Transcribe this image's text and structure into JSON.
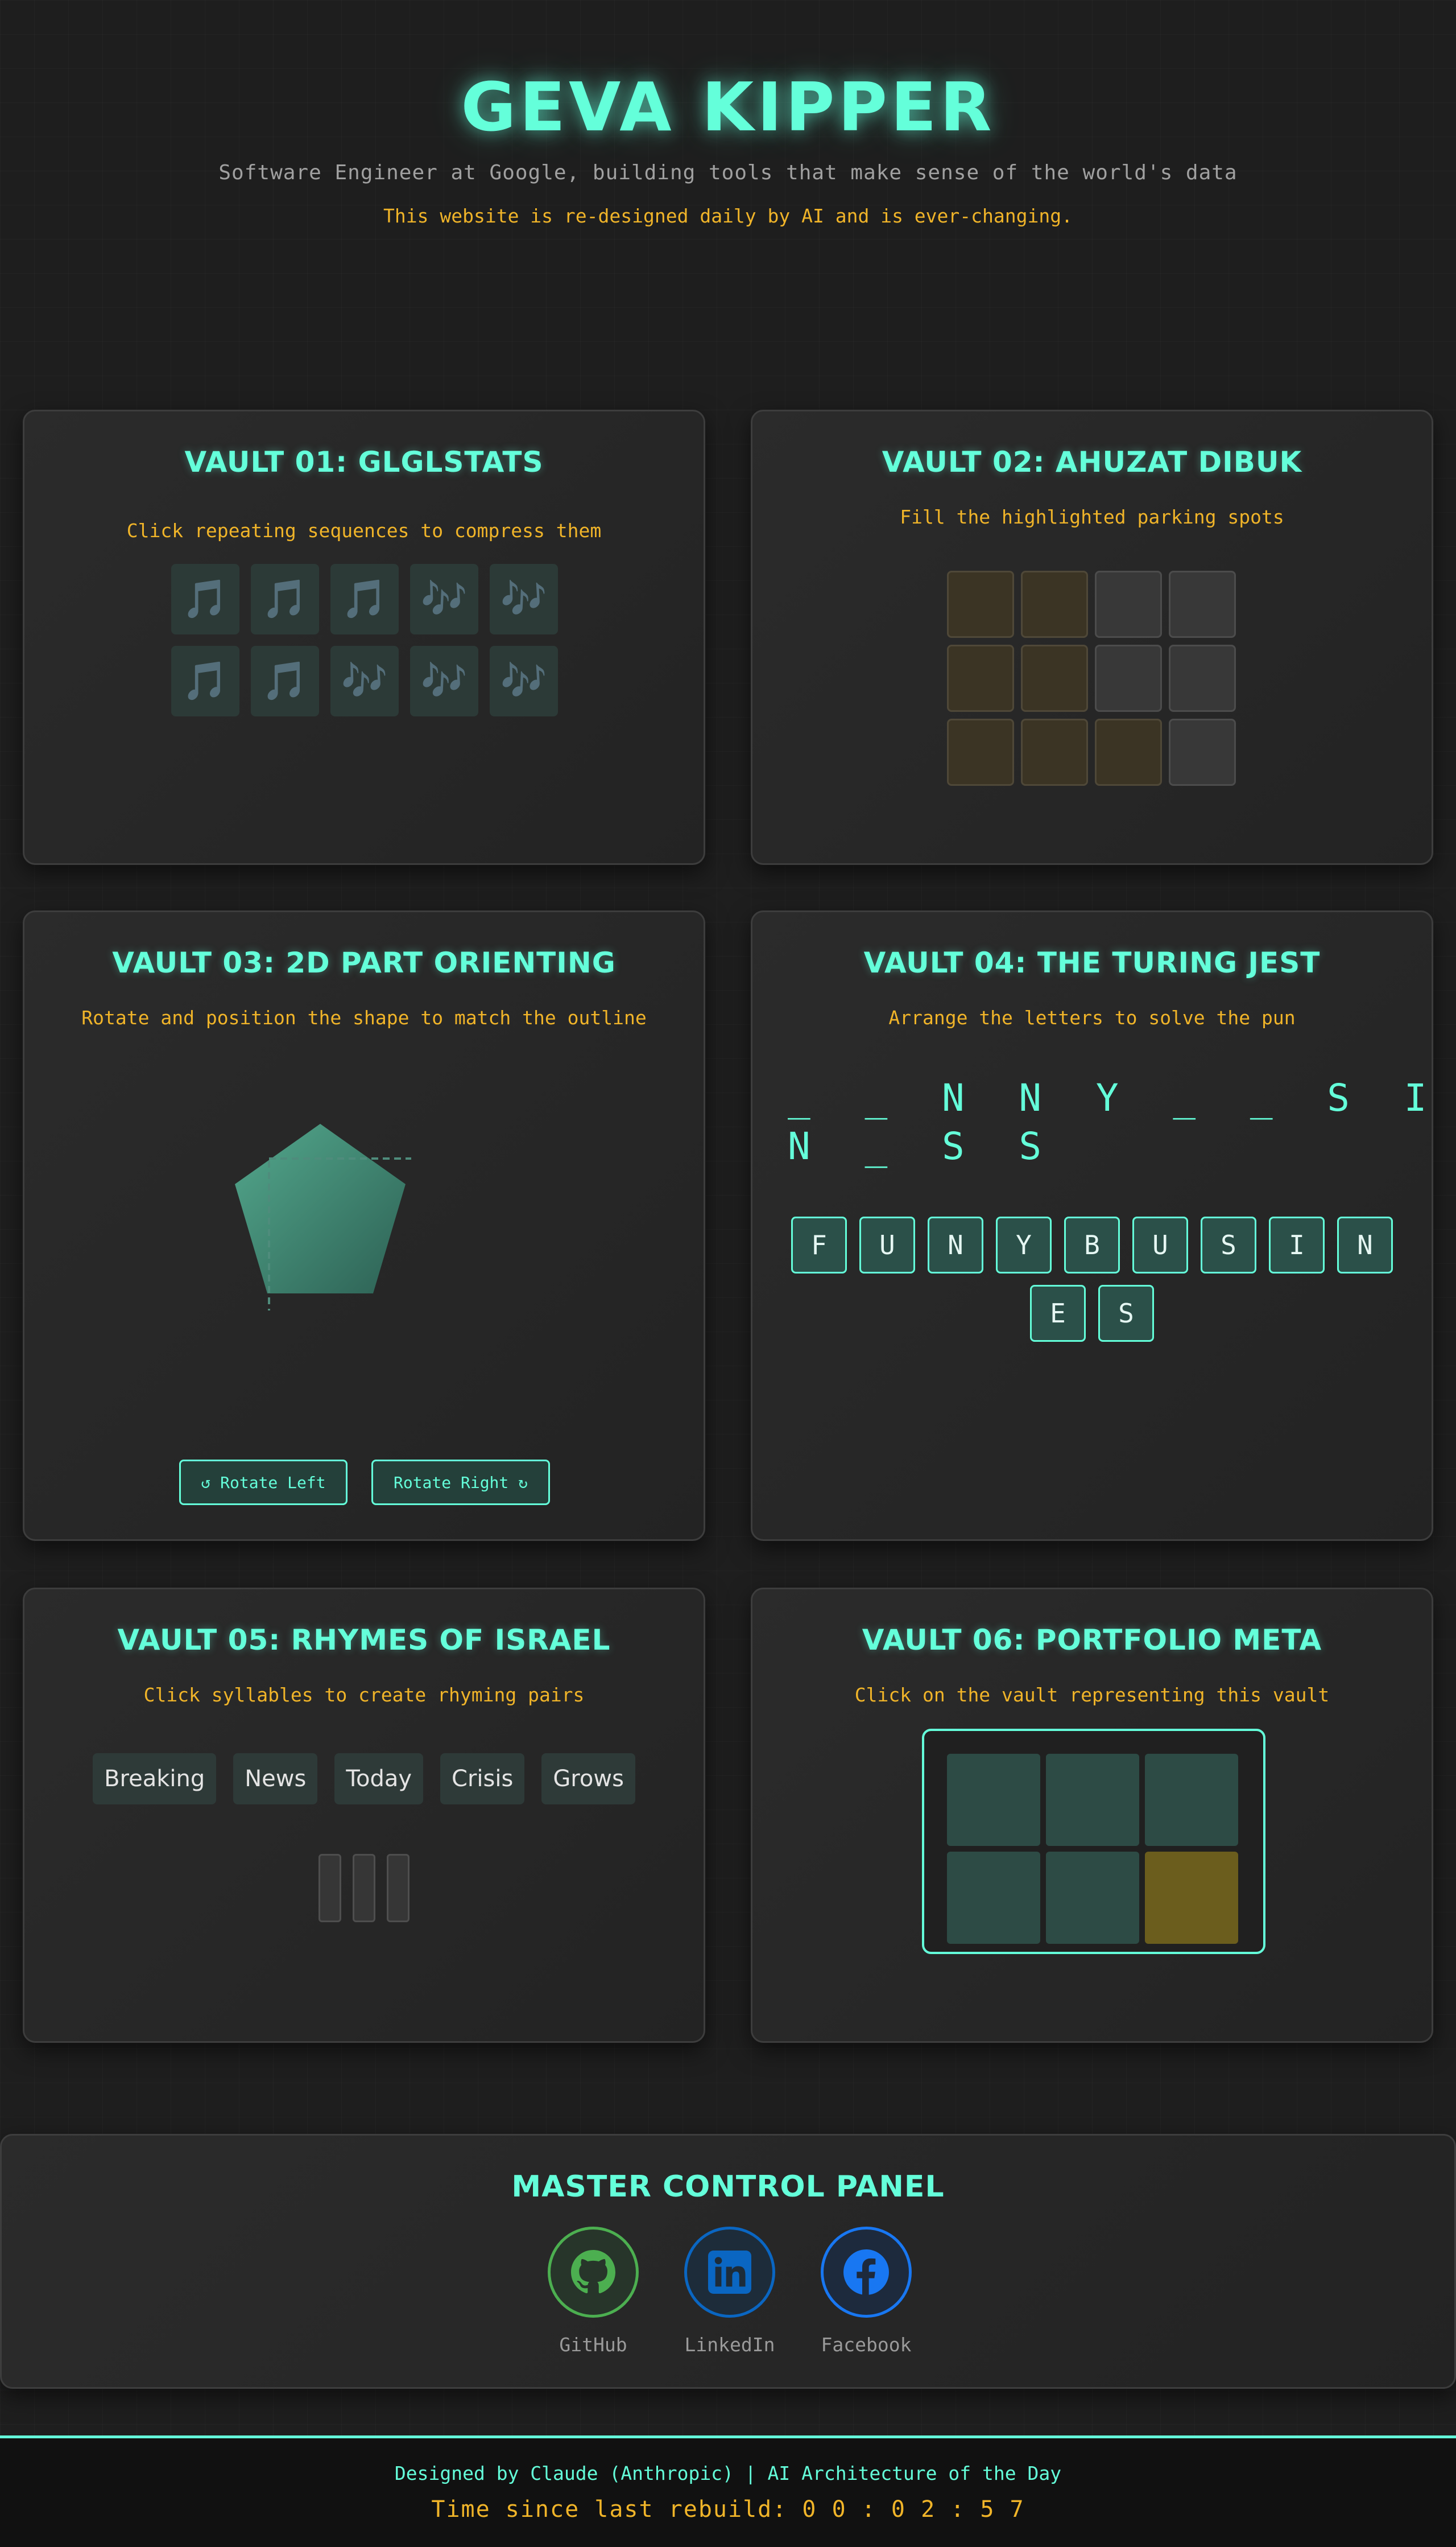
{
  "header": {
    "title": "GEVA KIPPER",
    "subtitle": "Software Engineer at Google, building tools that make sense of the world's data",
    "notice": "This website is re-designed daily by AI and is ever-changing."
  },
  "vaults": [
    {
      "title": "VAULT 01: GLGLSTATS",
      "instruction": "Click repeating sequences to compress them",
      "tiles": [
        "🎵",
        "🎵",
        "🎵",
        "🎶",
        "🎶",
        "🎵",
        "🎵",
        "🎶",
        "🎶",
        "🎶"
      ]
    },
    {
      "title": "VAULT 02: AHUZAT DIBUK",
      "instruction": "Fill the highlighted parking spots",
      "spots": [
        true,
        true,
        false,
        false,
        true,
        true,
        false,
        false,
        true,
        true,
        true,
        false
      ]
    },
    {
      "title": "VAULT 03: 2D PART ORIENTING",
      "instruction": "Rotate and position the shape to match the outline",
      "rotate_left_label": "↺ Rotate Left",
      "rotate_right_label": "Rotate Right ↻"
    },
    {
      "title": "VAULT 04: THE TURING JEST",
      "instruction": "Arrange the letters to solve the pun",
      "puzzle_line1": "_ _ N N Y _ _ S I",
      "puzzle_line2": "N _ S S",
      "letters_row1": [
        "F",
        "U",
        "N",
        "Y",
        "B",
        "U",
        "S",
        "I",
        "N"
      ],
      "letters_row2": [
        "E",
        "S"
      ]
    },
    {
      "title": "VAULT 05: RHYMES OF ISRAEL",
      "instruction": "Click syllables to create rhyming pairs",
      "syllables": [
        "Breaking",
        "News",
        "Today",
        "Crisis",
        "Grows"
      ]
    },
    {
      "title": "VAULT 06: PORTFOLIO META",
      "instruction": "Click on the vault representing this vault",
      "active_cell": 6
    }
  ],
  "control_panel": {
    "title": "MASTER CONTROL PANEL",
    "links": [
      {
        "label": "GitHub",
        "icon": "github-icon",
        "color": "#4caf50"
      },
      {
        "label": "LinkedIn",
        "icon": "linkedin-icon",
        "color": "#0a66c2"
      },
      {
        "label": "Facebook",
        "icon": "facebook-icon",
        "color": "#1877f2"
      }
    ]
  },
  "footer": {
    "credits": "Designed by Claude (Anthropic) | AI Architecture of the Day",
    "timer": "Time since last rebuild: 0 0 : 0 2 : 5 7"
  },
  "colors": {
    "accent": "#64ffda",
    "highlight": "#f0b429",
    "background": "#1e1e1e"
  }
}
